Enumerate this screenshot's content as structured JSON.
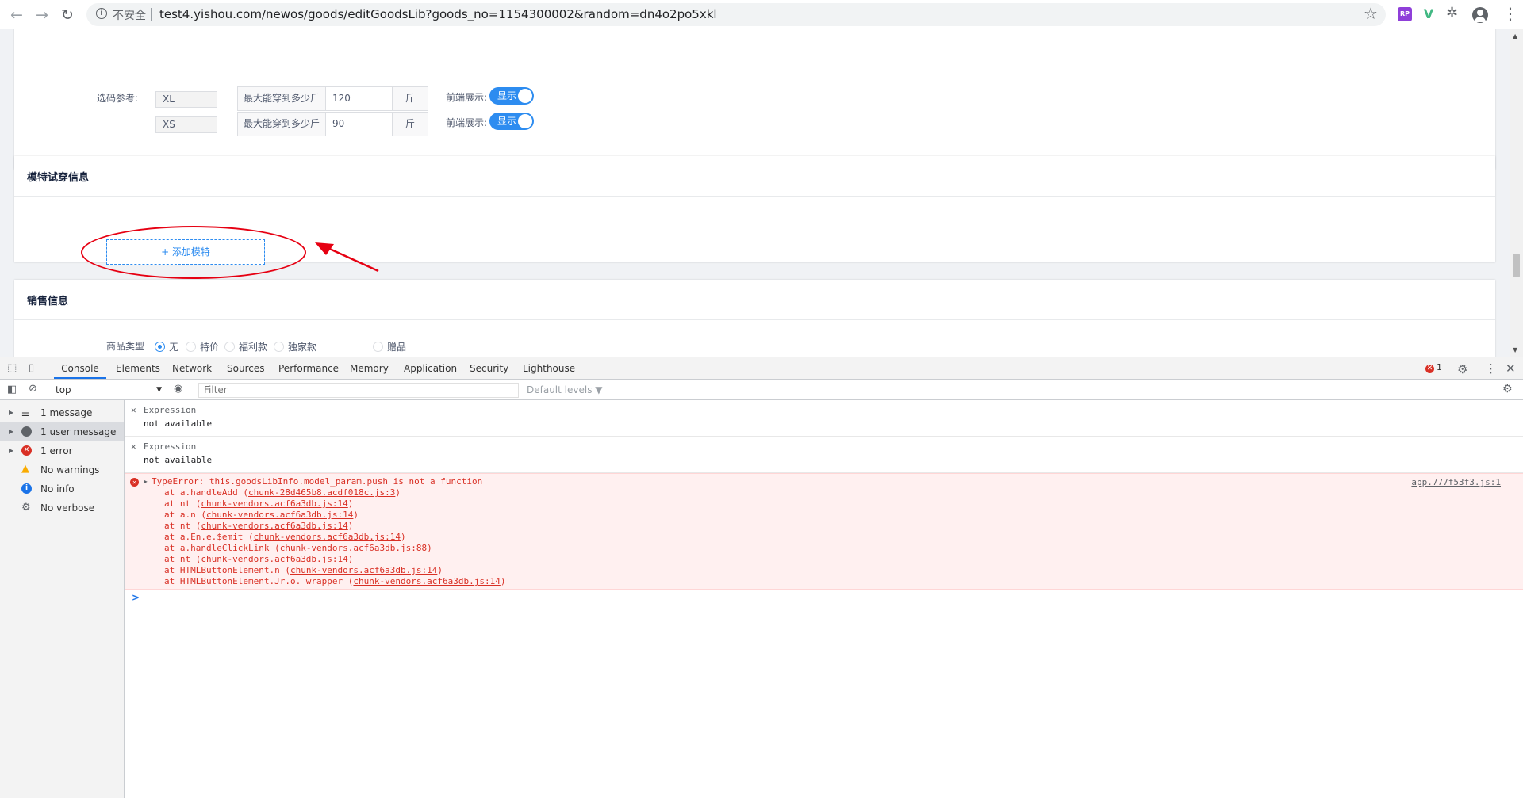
{
  "browser": {
    "security_label": "不安全",
    "url": "test4.yishou.com/newos/goods/editGoodsLib?goods_no=1154300002&random=dn4o2po5xkl",
    "ext_rp_label": "RP",
    "ext_vue_label": "V"
  },
  "card1": {
    "label": "选码参考:",
    "rows": [
      {
        "size": "XL",
        "prefix": "最大能穿到多少斤",
        "value": "120",
        "suffix": "斤",
        "display_label": "前端展示:",
        "switch_text": "显示"
      },
      {
        "size": "XS",
        "prefix": "最大能穿到多少斤",
        "value": "90",
        "suffix": "斤",
        "display_label": "前端展示:",
        "switch_text": "显示"
      }
    ]
  },
  "card2": {
    "title": "模特试穿信息",
    "add_model": "+  添加模特"
  },
  "card3": {
    "title": "销售信息",
    "type_label": "商品类型",
    "options": [
      "无",
      "特价",
      "福利款",
      "独家款",
      "赠品"
    ],
    "selected": "无"
  },
  "devtools": {
    "tabs": [
      "Console",
      "Elements",
      "Network",
      "Sources",
      "Performance",
      "Memory",
      "Application",
      "Security",
      "Lighthouse"
    ],
    "active_tab": "Console",
    "error_count": "1",
    "context": "top",
    "filter_placeholder": "Filter",
    "levels": "Default levels ▼",
    "sidebar": [
      {
        "text": "1 message",
        "icon": "list-icon"
      },
      {
        "text": "1 user message",
        "icon": "user-icon"
      },
      {
        "text": "1 error",
        "icon": "error-icon"
      },
      {
        "text": "No warnings",
        "icon": "warning-icon"
      },
      {
        "text": "No info",
        "icon": "info-icon"
      },
      {
        "text": "No verbose",
        "icon": "gear-icon"
      }
    ],
    "expressions": [
      {
        "name": "Expression",
        "value": "not available"
      },
      {
        "name": "Expression",
        "value": "not available"
      }
    ],
    "error": {
      "message": "TypeError: this.goodsLibInfo.model_param.push is not a function",
      "source": "app.777f53f3.js:1",
      "stack": [
        {
          "fn": "at a.handleAdd (",
          "loc": "chunk-28d465b8.acdf018c.js:3",
          "end": ")"
        },
        {
          "fn": "at nt (",
          "loc": "chunk-vendors.acf6a3db.js:14",
          "end": ")"
        },
        {
          "fn": "at a.n (",
          "loc": "chunk-vendors.acf6a3db.js:14",
          "end": ")"
        },
        {
          "fn": "at nt (",
          "loc": "chunk-vendors.acf6a3db.js:14",
          "end": ")"
        },
        {
          "fn": "at a.En.e.$emit (",
          "loc": "chunk-vendors.acf6a3db.js:14",
          "end": ")"
        },
        {
          "fn": "at a.handleClickLink (",
          "loc": "chunk-vendors.acf6a3db.js:88",
          "end": ")"
        },
        {
          "fn": "at nt (",
          "loc": "chunk-vendors.acf6a3db.js:14",
          "end": ")"
        },
        {
          "fn": "at HTMLButtonElement.n (",
          "loc": "chunk-vendors.acf6a3db.js:14",
          "end": ")"
        },
        {
          "fn": "at HTMLButtonElement.Jr.o._wrapper (",
          "loc": "chunk-vendors.acf6a3db.js:14",
          "end": ")"
        }
      ]
    },
    "prompt": ">"
  }
}
